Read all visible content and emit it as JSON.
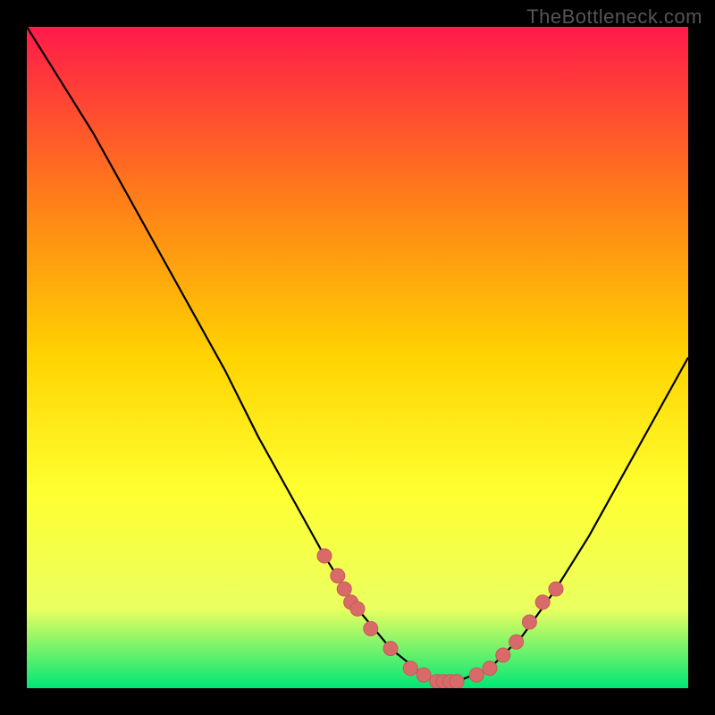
{
  "watermark": "TheBottleneck.com",
  "colors": {
    "background": "#000000",
    "gradient_top": "#ff1a4a",
    "gradient_mid1": "#ff7a1a",
    "gradient_mid2": "#ffd400",
    "gradient_mid3": "#ffff30",
    "gradient_mid4": "#eaff60",
    "gradient_bottom": "#00e676",
    "curve": "#000000",
    "marker": "#d96a6a",
    "marker_stroke": "#c85a5a"
  },
  "chart_data": {
    "type": "line",
    "title": "",
    "xlabel": "",
    "ylabel": "",
    "xlim": [
      0,
      100
    ],
    "ylim": [
      0,
      100
    ],
    "curve": {
      "x": [
        0,
        5,
        10,
        15,
        20,
        25,
        30,
        35,
        40,
        45,
        50,
        55,
        60,
        62,
        65,
        70,
        75,
        80,
        85,
        90,
        95,
        100
      ],
      "y": [
        100,
        92,
        84,
        75,
        66,
        57,
        48,
        38,
        29,
        20,
        12,
        6,
        2,
        1,
        1,
        3,
        8,
        15,
        23,
        32,
        41,
        50
      ]
    },
    "markers": {
      "x": [
        45,
        47,
        48,
        49,
        50,
        52,
        55,
        58,
        60,
        62,
        63,
        64,
        65,
        68,
        70,
        72,
        74,
        76,
        78,
        80
      ],
      "y": [
        20,
        17,
        15,
        13,
        12,
        9,
        6,
        3,
        2,
        1,
        1,
        1,
        1,
        2,
        3,
        5,
        7,
        10,
        13,
        15
      ]
    }
  }
}
